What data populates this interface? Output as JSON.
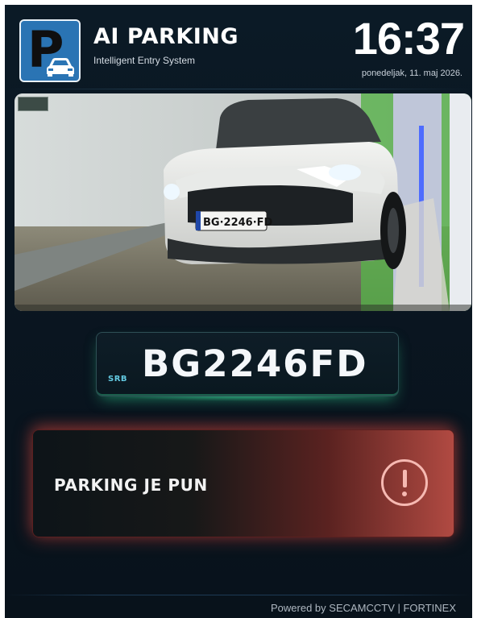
{
  "app": {
    "logo_letter": "P",
    "title": "AI PARKING",
    "subtitle": "Intelligent Entry System"
  },
  "clock": {
    "time": "16:37",
    "date": "ponedeljak, 11. maj 2026."
  },
  "camera": {
    "vehicle_plate_text": "BG·2246·FD"
  },
  "plate": {
    "country": "SRB",
    "number": "BG2246FD"
  },
  "alert": {
    "message": "PARKING JE PUN",
    "icon": "exclamation-circle-icon"
  },
  "footer": {
    "text": "Powered by SECAMCCTV | FORTINEX"
  },
  "colors": {
    "background": "#0a1621",
    "logo_blue": "#2a74b4",
    "plate_glow": "#3ce6a0",
    "alert_red": "#b14a42"
  }
}
